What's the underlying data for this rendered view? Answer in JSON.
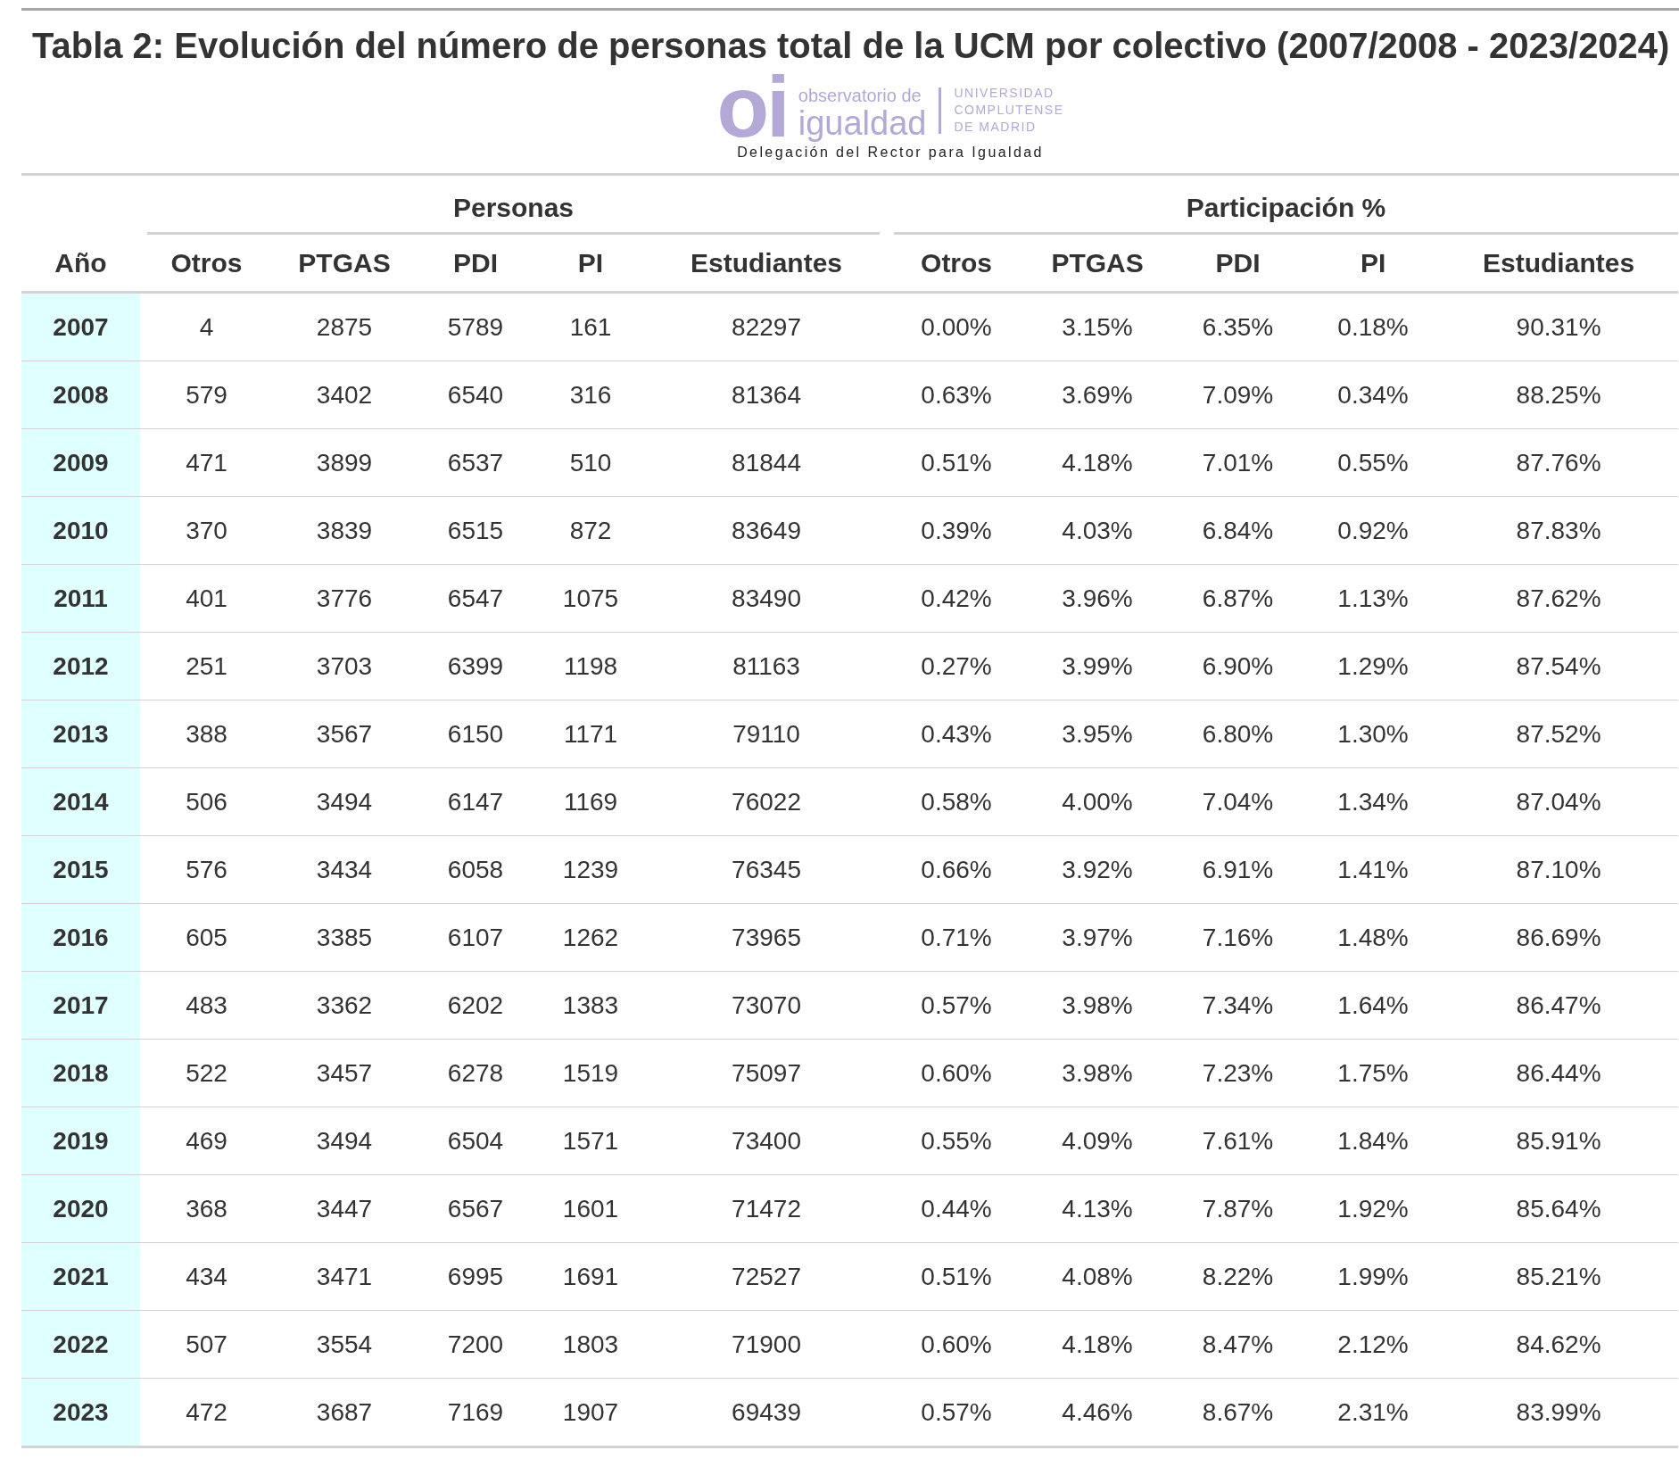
{
  "title": "Tabla 2: Evolución del número de personas total de la UCM por colectivo (2007/2008 - 2023/2024)",
  "logo": {
    "mark": "oi",
    "line_1": "observatorio de",
    "line_2": "igualdad",
    "university": [
      "UNIVERSIDAD",
      "COMPLUTENSE",
      "DE MADRID"
    ],
    "subtitle": "Delegación del Rector para Igualdad"
  },
  "spanners": [
    {
      "label": "Personas"
    },
    {
      "label": "Participación %"
    }
  ],
  "columns": [
    "Año",
    "Otros",
    "PTGAS",
    "PDI",
    "PI",
    "Estudiantes",
    "Otros",
    "PTGAS",
    "PDI",
    "PI",
    "Estudiantes"
  ],
  "rows": [
    {
      "year": "2007",
      "cells": [
        "4",
        "2875",
        "5789",
        "161",
        "82297",
        "0.00%",
        "3.15%",
        "6.35%",
        "0.18%",
        "90.31%"
      ]
    },
    {
      "year": "2008",
      "cells": [
        "579",
        "3402",
        "6540",
        "316",
        "81364",
        "0.63%",
        "3.69%",
        "7.09%",
        "0.34%",
        "88.25%"
      ]
    },
    {
      "year": "2009",
      "cells": [
        "471",
        "3899",
        "6537",
        "510",
        "81844",
        "0.51%",
        "4.18%",
        "7.01%",
        "0.55%",
        "87.76%"
      ]
    },
    {
      "year": "2010",
      "cells": [
        "370",
        "3839",
        "6515",
        "872",
        "83649",
        "0.39%",
        "4.03%",
        "6.84%",
        "0.92%",
        "87.83%"
      ]
    },
    {
      "year": "2011",
      "cells": [
        "401",
        "3776",
        "6547",
        "1075",
        "83490",
        "0.42%",
        "3.96%",
        "6.87%",
        "1.13%",
        "87.62%"
      ]
    },
    {
      "year": "2012",
      "cells": [
        "251",
        "3703",
        "6399",
        "1198",
        "81163",
        "0.27%",
        "3.99%",
        "6.90%",
        "1.29%",
        "87.54%"
      ]
    },
    {
      "year": "2013",
      "cells": [
        "388",
        "3567",
        "6150",
        "1171",
        "79110",
        "0.43%",
        "3.95%",
        "6.80%",
        "1.30%",
        "87.52%"
      ]
    },
    {
      "year": "2014",
      "cells": [
        "506",
        "3494",
        "6147",
        "1169",
        "76022",
        "0.58%",
        "4.00%",
        "7.04%",
        "1.34%",
        "87.04%"
      ]
    },
    {
      "year": "2015",
      "cells": [
        "576",
        "3434",
        "6058",
        "1239",
        "76345",
        "0.66%",
        "3.92%",
        "6.91%",
        "1.41%",
        "87.10%"
      ]
    },
    {
      "year": "2016",
      "cells": [
        "605",
        "3385",
        "6107",
        "1262",
        "73965",
        "0.71%",
        "3.97%",
        "7.16%",
        "1.48%",
        "86.69%"
      ]
    },
    {
      "year": "2017",
      "cells": [
        "483",
        "3362",
        "6202",
        "1383",
        "73070",
        "0.57%",
        "3.98%",
        "7.34%",
        "1.64%",
        "86.47%"
      ]
    },
    {
      "year": "2018",
      "cells": [
        "522",
        "3457",
        "6278",
        "1519",
        "75097",
        "0.60%",
        "3.98%",
        "7.23%",
        "1.75%",
        "86.44%"
      ]
    },
    {
      "year": "2019",
      "cells": [
        "469",
        "3494",
        "6504",
        "1571",
        "73400",
        "0.55%",
        "4.09%",
        "7.61%",
        "1.84%",
        "85.91%"
      ]
    },
    {
      "year": "2020",
      "cells": [
        "368",
        "3447",
        "6567",
        "1601",
        "71472",
        "0.44%",
        "4.13%",
        "7.87%",
        "1.92%",
        "85.64%"
      ]
    },
    {
      "year": "2021",
      "cells": [
        "434",
        "3471",
        "6995",
        "1691",
        "72527",
        "0.51%",
        "4.08%",
        "8.22%",
        "1.99%",
        "85.21%"
      ]
    },
    {
      "year": "2022",
      "cells": [
        "507",
        "3554",
        "7200",
        "1803",
        "71900",
        "0.60%",
        "4.18%",
        "8.47%",
        "2.12%",
        "84.62%"
      ]
    },
    {
      "year": "2023",
      "cells": [
        "472",
        "3687",
        "7169",
        "1907",
        "69439",
        "0.57%",
        "4.46%",
        "8.67%",
        "2.31%",
        "83.99%"
      ]
    }
  ]
}
